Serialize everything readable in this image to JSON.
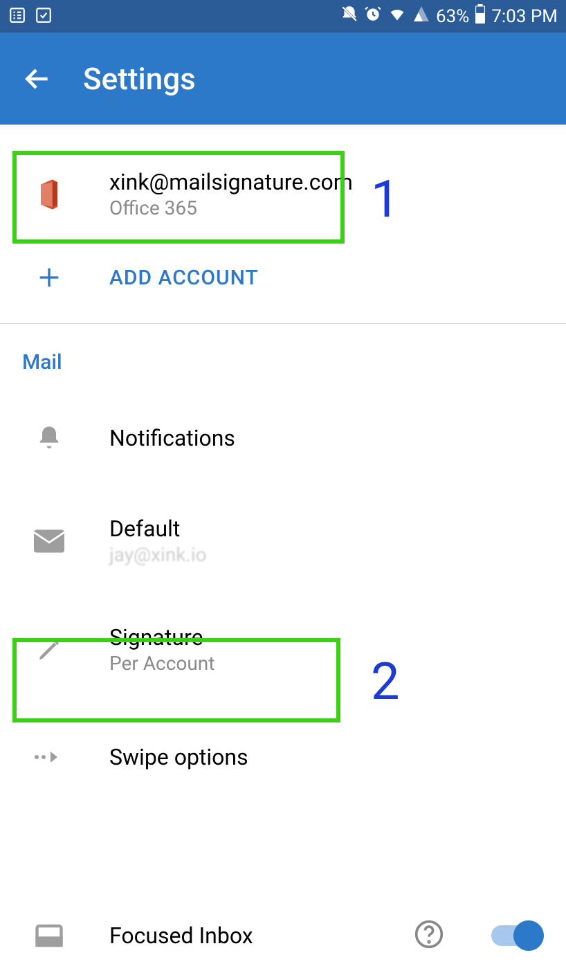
{
  "status_bar": {
    "battery_pct": "63%",
    "time": "7:03 PM"
  },
  "header": {
    "title": "Settings"
  },
  "account": {
    "email": "xink@mailsignature.com",
    "type": "Office 365"
  },
  "add_account_label": "ADD ACCOUNT",
  "section_mail": "Mail",
  "settings": {
    "notifications": {
      "title": "Notifications"
    },
    "default": {
      "title": "Default",
      "subtitle": "jay@xink.io"
    },
    "signature": {
      "title": "Signature",
      "subtitle": "Per Account"
    },
    "swipe": {
      "title": "Swipe options"
    },
    "focused": {
      "title": "Focused Inbox"
    }
  },
  "annotations": {
    "one": "1",
    "two": "2"
  }
}
